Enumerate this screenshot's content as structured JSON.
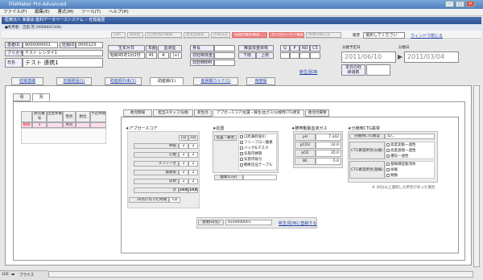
{
  "window": {
    "title": "FileMaker Pro Advanced"
  },
  "menu": [
    "ファイル(F)",
    "編集(E)",
    "書式(M)",
    "ツール(T)",
    "ヘルプ(H)"
  ],
  "app_header": "医療法人 孝壽会 産科データベースシステム :: 妊娠履歴",
  "login": "●利用者：吉田 茂 (0000001500)",
  "toolbar": [
    "GBS",
    "感染症",
    "前回妊娠の概要",
    "血液型検査",
    "外来日誌",
    "先回行動な確認",
    "カンガルーケア確認",
    "特殊分娩方法"
  ],
  "search": {
    "label": "帳票",
    "placeholder": "選択してください",
    "window_link": "ウィンドウ閉じる"
  },
  "patient": {
    "no_label": "患者ID",
    "no": "9000000001",
    "pregnancy_label": "妊娠ID",
    "pregnancy_no": "0000123",
    "kana_label": "フリガナ",
    "kana": "テスト レンタイ1",
    "name_label": "氏名",
    "name": "テスト 連携1",
    "birth_label": "生年月日",
    "birth": "昭和45年1月2日",
    "age_label": "年齢",
    "age": "41",
    "blood_label": "血液型",
    "blood_abo": "A",
    "blood_rh": "(+)",
    "height_label": "身長",
    "height": "",
    "weight_label": "非妊時体重",
    "weight": "",
    "chk_label": "非妊時BMI",
    "chk": "",
    "target_label": "推奨体重目標",
    "target_low": "下限",
    "target_high": "上限",
    "gpnd": [
      "G",
      "P",
      "ND",
      "CS"
    ],
    "due_label": "分娩予定日",
    "due": "2011/06/10",
    "actual_label": "分娩日",
    "actual": "2011/03/04",
    "reg_label": "本日の妊婦週数"
  },
  "new_case_link": "新生児DB",
  "main_tabs": [
    "妊娠基礎",
    "妊娠経過(1)",
    "助産師外来(1)",
    "助産録(1)",
    "産褥期カルテ(1)",
    "用度帳"
  ],
  "sub_tabs": [
    "母",
    "児"
  ],
  "baby_table": {
    "headers": [
      "胎児番号",
      "出生体重",
      "性別",
      "胎位",
      "予定時間"
    ],
    "row": {
      "delete": "削除",
      "no": "1",
      "weight": "",
      "sex": "男児",
      "pos": "",
      "time": ""
    }
  },
  "inner_tabs": [
    "胎児情報",
    "担当スタッフ/分娩",
    "新生児",
    "アプガースコア/処置・蘇生/血ガス/分娩時CTG異常",
    "胎児付属物"
  ],
  "apgar": {
    "title": "★アプガースコア",
    "col1": "1分",
    "col5": "5分",
    "rows": [
      {
        "label": "呼吸",
        "v1": "2",
        "v5": "2"
      },
      {
        "label": "心拍",
        "v1": "2",
        "v5": "2"
      },
      {
        "label": "チアノーゼ",
        "v1": "2",
        "v5": "2"
      },
      {
        "label": "筋緊張",
        "v1": "2",
        "v5": "2"
      },
      {
        "label": "反射",
        "v1": "2",
        "v5": "2"
      },
      {
        "label": "計",
        "v1": "10点",
        "v5": "10点"
      },
      {
        "label": "10点になった時間",
        "v1": "1分",
        "v5": ""
      }
    ]
  },
  "care": {
    "title": "★処置",
    "row_label": "処置・蘇生",
    "items": [
      "口腔鼻腔吸引",
      "フリーフロー酸素",
      "バッグ&マスク",
      "気管内挿管",
      "気管内吸引",
      "胸骨圧迫テープル"
    ],
    "score_label": "酸素(L/分)",
    "score": ""
  },
  "gas": {
    "title": "★臍帯動脈血液ガス",
    "rows": [
      {
        "label": "pH",
        "value": "7.342"
      },
      {
        "label": "pCO2",
        "value": "32.0"
      },
      {
        "label": "pO2",
        "value": "35.0"
      },
      {
        "label": "BE",
        "value": "-5.0"
      }
    ]
  },
  "ctg": {
    "title": "★分娩時CTG異常",
    "abnormal_label": "分娩時CTG異常",
    "abnormal": "なし",
    "found_label": "CTG異常所見(分娩)",
    "found_items": [
      "高度変動一過性",
      "高度遅発一過性",
      "遷延一過性"
    ],
    "trend_label": "CTG異常所見(基線)",
    "trend_items": [
      "基線細変動消失",
      "徐脈",
      "頻脈"
    ],
    "note": "※ 30分以上連続した所見があった場合"
  },
  "footer": {
    "id_label": "患者ID(児)",
    "id": "9100000001",
    "link": "新生児DBに登録する"
  },
  "status": {
    "zoom": "100",
    "mode": "ブラウズ"
  }
}
